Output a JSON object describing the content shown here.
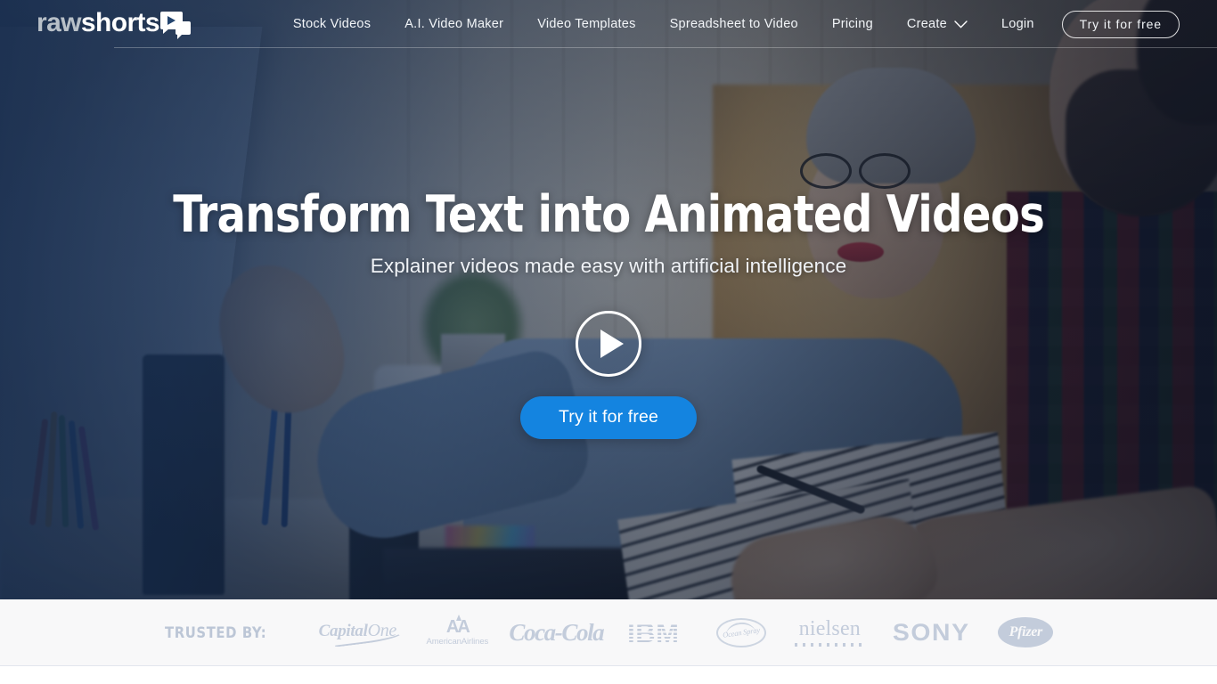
{
  "brand": {
    "logo_raw": "raw",
    "logo_shorts": "shorts",
    "logo_mark_icon": "video-chat-bubble-icon",
    "accent_blue": "#1484e0",
    "overlay_blue": "#1a3a69"
  },
  "nav": {
    "items": [
      {
        "label": "Stock Videos",
        "name": "nav-stock-videos"
      },
      {
        "label": "A.I. Video Maker",
        "name": "nav-ai-video-maker"
      },
      {
        "label": "Video Templates",
        "name": "nav-video-templates"
      },
      {
        "label": "Spreadsheet to Video",
        "name": "nav-spreadsheet-to-video"
      },
      {
        "label": "Pricing",
        "name": "nav-pricing"
      },
      {
        "label": "Create",
        "name": "nav-create",
        "has_dropdown": true
      },
      {
        "label": "Login",
        "name": "nav-login"
      }
    ],
    "create_label": "Create",
    "login_label": "Login",
    "cta_label": "Try it for free",
    "chevron_icon": "chevron-down-icon"
  },
  "hero": {
    "title": "Transform Text into Animated Videos",
    "subtitle": "Explainer videos made easy with artificial intelligence",
    "play_icon": "play-circle-icon",
    "cta_label": "Try it for free"
  },
  "trusted": {
    "label": "TRUSTED BY:",
    "logo_color": "#c3ccdb",
    "band_background": "#f8f8f9",
    "logos": [
      {
        "name": "capital-one",
        "word": "Capital",
        "word2": "One"
      },
      {
        "name": "american-airlines",
        "mark": "AA",
        "word": "AmericanAirlines"
      },
      {
        "name": "coca-cola",
        "word": "Coca-Cola"
      },
      {
        "name": "ibm",
        "word": "IBM"
      },
      {
        "name": "ocean-spray",
        "word": "Ocean Spray"
      },
      {
        "name": "nielsen",
        "word": "nielsen"
      },
      {
        "name": "sony",
        "word": "SONY"
      },
      {
        "name": "pfizer",
        "word": "Pfizer"
      }
    ]
  }
}
